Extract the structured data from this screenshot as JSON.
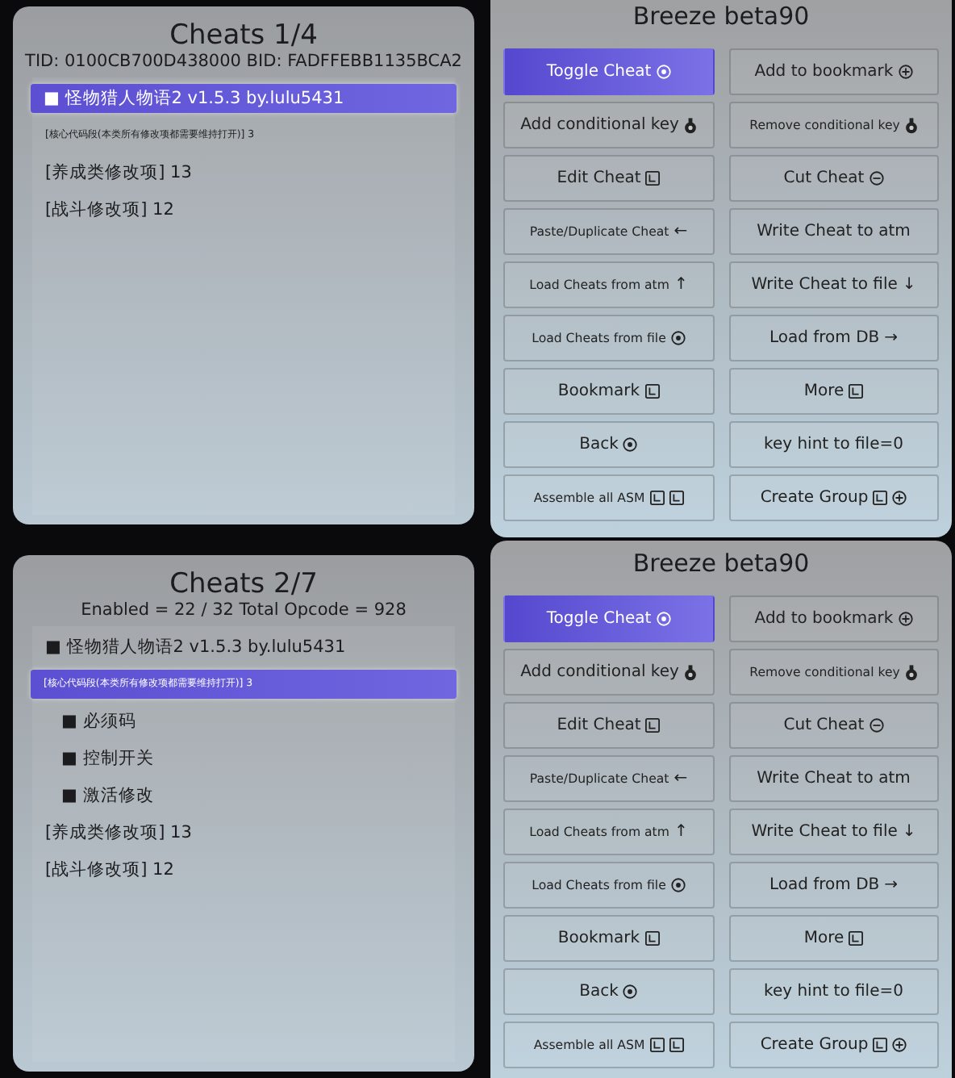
{
  "screens": [
    {
      "cheats_panel": {
        "title": "Cheats 1/4",
        "subtitle": "TID: 0100CB700D438000  BID: FADFFEBB1135BCA2",
        "rows": [
          {
            "label": "■ 怪物猎人物语2 v1.5.3 by.lulu5431",
            "selected": true,
            "small": false
          },
          {
            "label": "[核心代码段(本类所有修改项都需要维持打开)] 3",
            "selected": false,
            "small": true
          },
          {
            "label": "[养成类修改项] 13",
            "selected": false,
            "small": false
          },
          {
            "label": "[战斗修改项] 12",
            "selected": false,
            "small": false
          }
        ]
      },
      "menu_panel": {
        "title": "Breeze beta90",
        "buttons": [
          {
            "label": "Toggle Cheat",
            "selected": true,
            "small": false,
            "icons": [
              {
                "kind": "circle"
              }
            ]
          },
          {
            "label": "Add to bookmark",
            "selected": false,
            "small": false,
            "icons": [
              {
                "kind": "circle-plus"
              }
            ]
          },
          {
            "label": "Add conditional key",
            "selected": false,
            "small": false,
            "icons": [
              {
                "kind": "stick"
              }
            ]
          },
          {
            "label": "Remove conditional key",
            "selected": false,
            "small": true,
            "icons": [
              {
                "kind": "stick"
              }
            ]
          },
          {
            "label": "Edit Cheat",
            "selected": false,
            "small": false,
            "icons": [
              {
                "kind": "box"
              }
            ]
          },
          {
            "label": "Cut Cheat",
            "selected": false,
            "small": false,
            "icons": [
              {
                "kind": "circle-minus"
              }
            ]
          },
          {
            "label": "Paste/Duplicate Cheat",
            "selected": false,
            "small": true,
            "icons": [
              {
                "kind": "arrow",
                "glyph": "←"
              }
            ]
          },
          {
            "label": "Write Cheat to atm",
            "selected": false,
            "small": false
          },
          {
            "label": "Load Cheats from atm",
            "selected": false,
            "small": true,
            "icons": [
              {
                "kind": "arrow",
                "glyph": "↑"
              }
            ]
          },
          {
            "label": "Write Cheat to file",
            "selected": false,
            "small": false,
            "icons": [
              {
                "kind": "arrow",
                "glyph": "↓"
              }
            ]
          },
          {
            "label": "Load Cheats from file",
            "selected": false,
            "small": true,
            "icons": [
              {
                "kind": "circle"
              }
            ]
          },
          {
            "label": "Load from DB",
            "selected": false,
            "small": false,
            "icons": [
              {
                "kind": "arrow",
                "glyph": "→"
              }
            ]
          },
          {
            "label": "Bookmark",
            "selected": false,
            "small": false,
            "icons": [
              {
                "kind": "box"
              }
            ]
          },
          {
            "label": "More",
            "selected": false,
            "small": false,
            "icons": [
              {
                "kind": "box"
              }
            ]
          },
          {
            "label": "Back",
            "selected": false,
            "small": false,
            "icons": [
              {
                "kind": "circle"
              }
            ]
          },
          {
            "label": "key hint to file=0",
            "selected": false,
            "small": false
          },
          {
            "label": "Assemble all ASM",
            "selected": false,
            "small": true,
            "icons": [
              {
                "kind": "box"
              },
              {
                "kind": "box"
              }
            ]
          },
          {
            "label": "Create Group",
            "selected": false,
            "small": false,
            "icons": [
              {
                "kind": "box"
              },
              {
                "kind": "circle-plus"
              }
            ]
          }
        ]
      }
    },
    {
      "cheats_panel": {
        "title": "Cheats 2/7",
        "subtitle": "Enabled = 22 / 32  Total Opcode = 928",
        "rows": [
          {
            "label": "■ 怪物猎人物语2 v1.5.3 by.lulu5431",
            "selected": false,
            "small": false
          },
          {
            "label": "[核心代码段(本类所有修改项都需要维持打开)] 3",
            "selected": true,
            "small": true,
            "children": [
              {
                "label": "■ 必须码",
                "selected": false,
                "small": false
              },
              {
                "label": "■ 控制开关",
                "selected": false,
                "small": false
              },
              {
                "label": "■ 激活修改",
                "selected": false,
                "small": false
              }
            ]
          },
          {
            "label": "[养成类修改项] 13",
            "selected": false,
            "small": false
          },
          {
            "label": "[战斗修改项] 12",
            "selected": false,
            "small": false
          }
        ]
      },
      "menu_panel": {
        "title": "Breeze beta90",
        "buttons": [
          {
            "label": "Toggle Cheat",
            "selected": true,
            "small": false,
            "icons": [
              {
                "kind": "circle"
              }
            ]
          },
          {
            "label": "Add to bookmark",
            "selected": false,
            "small": false,
            "icons": [
              {
                "kind": "circle-plus"
              }
            ]
          },
          {
            "label": "Add conditional key",
            "selected": false,
            "small": false,
            "icons": [
              {
                "kind": "stick"
              }
            ]
          },
          {
            "label": "Remove conditional key",
            "selected": false,
            "small": true,
            "icons": [
              {
                "kind": "stick"
              }
            ]
          },
          {
            "label": "Edit Cheat",
            "selected": false,
            "small": false,
            "icons": [
              {
                "kind": "box"
              }
            ]
          },
          {
            "label": "Cut Cheat",
            "selected": false,
            "small": false,
            "icons": [
              {
                "kind": "circle-minus"
              }
            ]
          },
          {
            "label": "Paste/Duplicate Cheat",
            "selected": false,
            "small": true,
            "icons": [
              {
                "kind": "arrow",
                "glyph": "←"
              }
            ]
          },
          {
            "label": "Write Cheat to atm",
            "selected": false,
            "small": false
          },
          {
            "label": "Load Cheats from atm",
            "selected": false,
            "small": true,
            "icons": [
              {
                "kind": "arrow",
                "glyph": "↑"
              }
            ]
          },
          {
            "label": "Write Cheat to file",
            "selected": false,
            "small": false,
            "icons": [
              {
                "kind": "arrow",
                "glyph": "↓"
              }
            ]
          },
          {
            "label": "Load Cheats from file",
            "selected": false,
            "small": true,
            "icons": [
              {
                "kind": "circle"
              }
            ]
          },
          {
            "label": "Load from DB",
            "selected": false,
            "small": false,
            "icons": [
              {
                "kind": "arrow",
                "glyph": "→"
              }
            ]
          },
          {
            "label": "Bookmark",
            "selected": false,
            "small": false,
            "icons": [
              {
                "kind": "box"
              }
            ]
          },
          {
            "label": "More",
            "selected": false,
            "small": false,
            "icons": [
              {
                "kind": "box"
              }
            ]
          },
          {
            "label": "Back",
            "selected": false,
            "small": false,
            "icons": [
              {
                "kind": "circle"
              }
            ]
          },
          {
            "label": "key hint to file=0",
            "selected": false,
            "small": false
          },
          {
            "label": "Assemble all ASM",
            "selected": false,
            "small": true,
            "icons": [
              {
                "kind": "box"
              },
              {
                "kind": "box"
              }
            ]
          },
          {
            "label": "Create Group",
            "selected": false,
            "small": false,
            "icons": [
              {
                "kind": "box"
              },
              {
                "kind": "circle-plus"
              }
            ]
          }
        ]
      }
    }
  ]
}
